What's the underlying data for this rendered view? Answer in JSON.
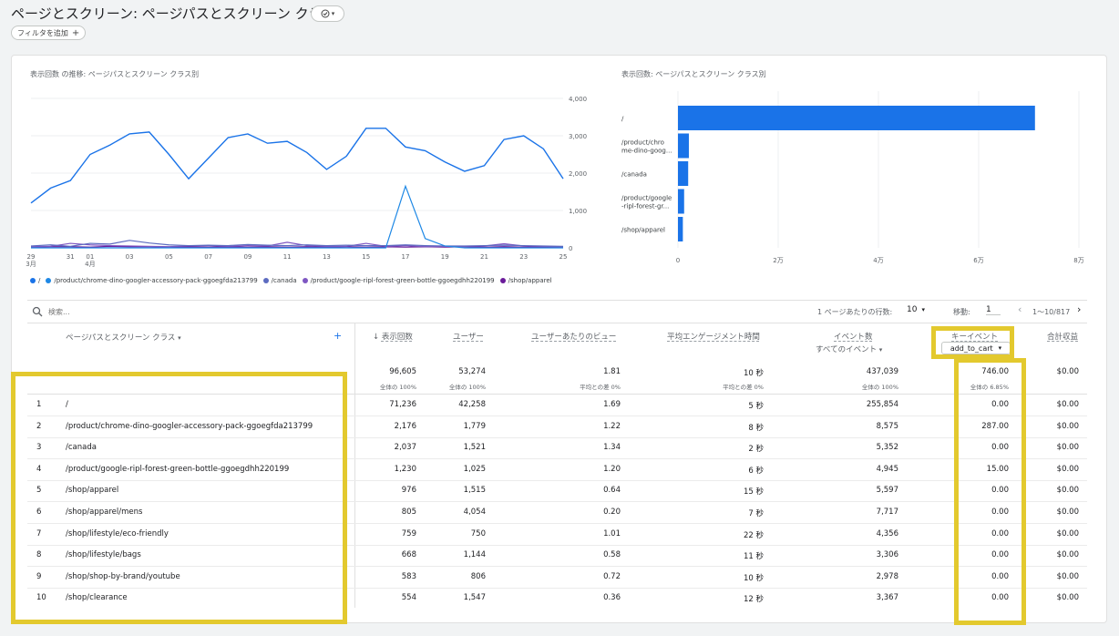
{
  "page_title": "ページとスクリーン: ページパスとスクリーン クラス",
  "title_badge_icon": "check-circle-icon",
  "add_filter_label": "フィルタを追加",
  "line_chart": {
    "title": "表示回数 の推移: ページパスとスクリーン クラス別",
    "y_ticks": [
      "4,000",
      "3,000",
      "2,000",
      "1,000",
      "0"
    ],
    "x_ticks": [
      "29\n3月",
      "31",
      "01\n4月",
      "03",
      "05",
      "07",
      "09",
      "11",
      "13",
      "15",
      "17",
      "19",
      "21",
      "23",
      "25"
    ]
  },
  "bar_chart": {
    "title": "表示回数: ページパスとスクリーン クラス別",
    "labels": [
      "/",
      "/product/chro\nme-dino-goog...",
      "/canada",
      "/product/google\n-ripl-forest-gr...",
      "/shop/apparel"
    ],
    "x_ticks": [
      "0",
      "2万",
      "4万",
      "6万",
      "8万"
    ]
  },
  "legend": [
    {
      "label": "/",
      "color": "#1a73e8"
    },
    {
      "label": "/product/chrome-dino-googler-accessory-pack-ggoegfda213799",
      "color": "#1e88e5"
    },
    {
      "label": "/canada",
      "color": "#5c6bc0"
    },
    {
      "label": "/product/google-ripl-forest-green-bottle-ggoegdhh220199",
      "color": "#7e57c2"
    },
    {
      "label": "/shop/apparel",
      "color": "#6a1b9a"
    }
  ],
  "chart_data": [
    {
      "type": "line",
      "title": "表示回数 の推移: ページパスとスクリーン クラス別",
      "ylim": [
        0,
        4000
      ],
      "x": [
        "3/29",
        "3/30",
        "3/31",
        "4/01",
        "4/02",
        "4/03",
        "4/04",
        "4/05",
        "4/06",
        "4/07",
        "4/08",
        "4/09",
        "4/10",
        "4/11",
        "4/12",
        "4/13",
        "4/14",
        "4/15",
        "4/16",
        "4/17",
        "4/18",
        "4/19",
        "4/20",
        "4/21",
        "4/22",
        "4/23",
        "4/24",
        "4/25"
      ],
      "series": [
        {
          "name": "/",
          "color": "#1a73e8",
          "values": [
            1200,
            1600,
            1800,
            2500,
            2750,
            3050,
            3100,
            2500,
            1850,
            2400,
            2950,
            3050,
            2800,
            2850,
            2550,
            2100,
            2450,
            3200,
            3200,
            2700,
            2600,
            2300,
            2050,
            2200,
            2900,
            3000,
            2650,
            1850
          ]
        },
        {
          "name": "/product/chrome-dino-googler-accessory-pack-ggoegfda213799",
          "color": "#1e88e5",
          "values": [
            0,
            0,
            0,
            0,
            0,
            0,
            0,
            0,
            0,
            0,
            0,
            0,
            0,
            0,
            0,
            0,
            0,
            0,
            0,
            1650,
            250,
            50,
            0,
            0,
            0,
            0,
            0,
            0
          ]
        },
        {
          "name": "/canada",
          "color": "#5c6bc0",
          "values": [
            50,
            80,
            40,
            120,
            100,
            200,
            130,
            80,
            60,
            70,
            60,
            90,
            70,
            60,
            80,
            60,
            70,
            60,
            60,
            80,
            60,
            50,
            50,
            60,
            70,
            60,
            50,
            40
          ]
        },
        {
          "name": "/product/google-ripl-forest-green-bottle-ggoegdhh220199",
          "color": "#7e57c2",
          "values": [
            30,
            40,
            120,
            80,
            60,
            50,
            40,
            30,
            50,
            60,
            40,
            60,
            50,
            150,
            60,
            40,
            40,
            120,
            40,
            60,
            30,
            40,
            40,
            50,
            110,
            50,
            40,
            30
          ]
        },
        {
          "name": "/shop/apparel",
          "color": "#6a1b9a",
          "values": [
            20,
            30,
            30,
            20,
            40,
            30,
            30,
            20,
            30,
            20,
            30,
            20,
            30,
            20,
            30,
            20,
            30,
            20,
            30,
            20,
            30,
            20,
            30,
            20,
            30,
            20,
            30,
            20
          ]
        }
      ]
    },
    {
      "type": "bar",
      "title": "表示回数: ページパスとスクリーン クラス別",
      "categories": [
        "/",
        "/product/chrome-dino-googler-accessory-pack-ggoegfda213799",
        "/canada",
        "/product/google-ripl-forest-green-bottle-ggoegdhh220199",
        "/shop/apparel"
      ],
      "values": [
        71236,
        2176,
        2037,
        1230,
        976
      ],
      "xlim": [
        0,
        80000
      ]
    }
  ],
  "table": {
    "search_placeholder": "検索...",
    "rows_per_page_label": "1 ページあたりの行数:",
    "rows_per_page": "10",
    "goto_label": "移動:",
    "goto_value": "1",
    "range": "1〜10/817",
    "headers": {
      "dimension": "ページパスとスクリーン クラス",
      "views": "表示回数",
      "users": "ユーザー",
      "views_per_user": "ユーザーあたりのビュー",
      "avg_engagement": "平均エンゲージメント時間",
      "events": "イベント数",
      "events_sub": "すべてのイベント",
      "key_events": "キーイベント",
      "key_events_sub": "add_to_cart",
      "revenue": "合計収益"
    },
    "totals": {
      "views": "96,605",
      "views_sub": "全体の 100%",
      "users": "53,274",
      "users_sub": "全体の 100%",
      "views_per_user": "1.81",
      "views_per_user_sub": "平均との差 0%",
      "avg_engagement": "10 秒",
      "avg_engagement_sub": "平均との差 0%",
      "events": "437,039",
      "events_sub": "全体の 100%",
      "key_events": "746.00",
      "key_events_sub": "全体の 6.85%",
      "revenue": "$0.00"
    },
    "rows": [
      {
        "n": "1",
        "path": "/",
        "views": "71,236",
        "users": "42,258",
        "vpu": "1.69",
        "eng": "5 秒",
        "events": "255,854",
        "key": "0.00",
        "rev": "$0.00"
      },
      {
        "n": "2",
        "path": "/product/chrome-dino-googler-accessory-pack-ggoegfda213799",
        "views": "2,176",
        "users": "1,779",
        "vpu": "1.22",
        "eng": "8 秒",
        "events": "8,575",
        "key": "287.00",
        "rev": "$0.00"
      },
      {
        "n": "3",
        "path": "/canada",
        "views": "2,037",
        "users": "1,521",
        "vpu": "1.34",
        "eng": "2 秒",
        "events": "5,352",
        "key": "0.00",
        "rev": "$0.00"
      },
      {
        "n": "4",
        "path": "/product/google-ripl-forest-green-bottle-ggoegdhh220199",
        "views": "1,230",
        "users": "1,025",
        "vpu": "1.20",
        "eng": "6 秒",
        "events": "4,945",
        "key": "15.00",
        "rev": "$0.00"
      },
      {
        "n": "5",
        "path": "/shop/apparel",
        "views": "976",
        "users": "1,515",
        "vpu": "0.64",
        "eng": "15 秒",
        "events": "5,597",
        "key": "0.00",
        "rev": "$0.00"
      },
      {
        "n": "6",
        "path": "/shop/apparel/mens",
        "views": "805",
        "users": "4,054",
        "vpu": "0.20",
        "eng": "7 秒",
        "events": "7,717",
        "key": "0.00",
        "rev": "$0.00"
      },
      {
        "n": "7",
        "path": "/shop/lifestyle/eco-friendly",
        "views": "759",
        "users": "750",
        "vpu": "1.01",
        "eng": "22 秒",
        "events": "4,356",
        "key": "0.00",
        "rev": "$0.00"
      },
      {
        "n": "8",
        "path": "/shop/lifestyle/bags",
        "views": "668",
        "users": "1,144",
        "vpu": "0.58",
        "eng": "11 秒",
        "events": "3,306",
        "key": "0.00",
        "rev": "$0.00"
      },
      {
        "n": "9",
        "path": "/shop/shop-by-brand/youtube",
        "views": "583",
        "users": "806",
        "vpu": "0.72",
        "eng": "10 秒",
        "events": "2,978",
        "key": "0.00",
        "rev": "$0.00"
      },
      {
        "n": "10",
        "path": "/shop/clearance",
        "views": "554",
        "users": "1,547",
        "vpu": "0.36",
        "eng": "12 秒",
        "events": "3,367",
        "key": "0.00",
        "rev": "$0.00"
      }
    ]
  },
  "highlight_color": "#e3c92e"
}
